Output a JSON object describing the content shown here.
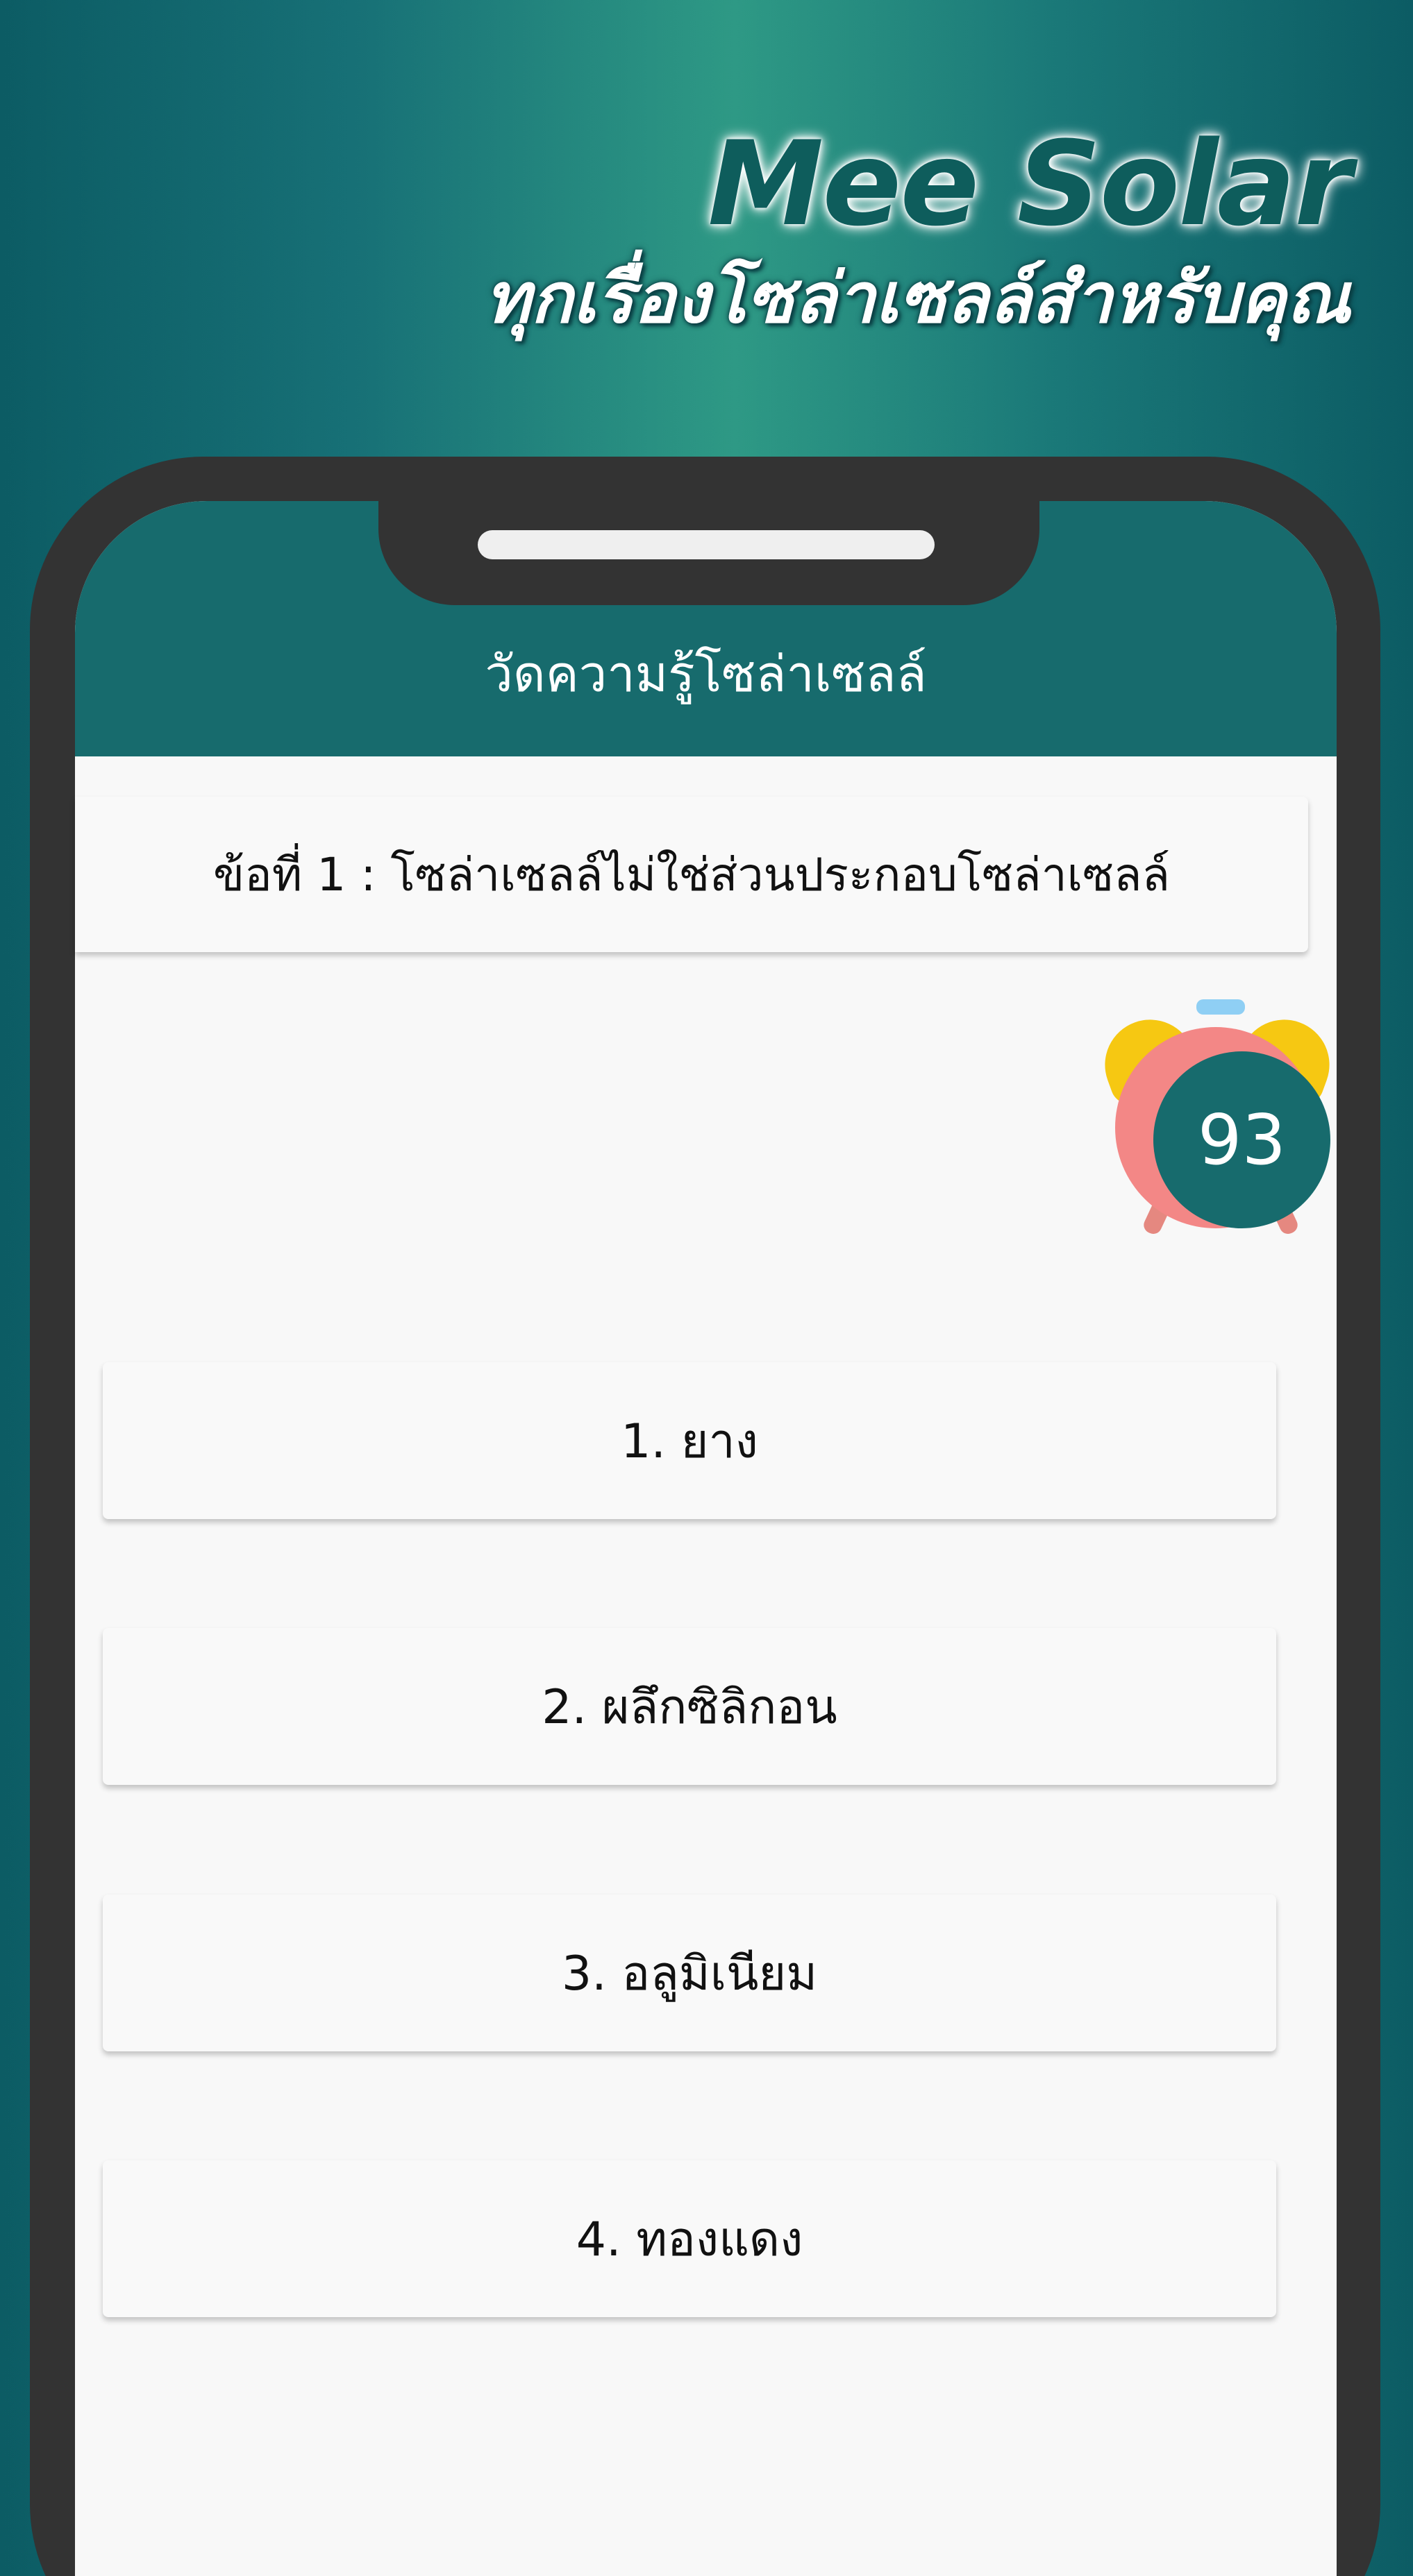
{
  "promo": {
    "brand": "Mee Solar",
    "tagline": "ทุกเรื่องโซล่าเซลล์สำหรับคุณ"
  },
  "app": {
    "title": "วัดความรู้โซล่าเซลล์"
  },
  "quiz": {
    "question": "ข้อที่ 1 : โซล่าเซลล์ไม่ใช่ส่วนประกอบโซล่าเซลล์",
    "timer": "93",
    "answers": [
      {
        "label": "1. ยาง"
      },
      {
        "label": "2. ผลึกซิลิกอน"
      },
      {
        "label": "3. อลูมิเนียม"
      },
      {
        "label": "4. ทองแดง"
      }
    ]
  },
  "colors": {
    "primary": "#176b6d",
    "brand_text": "#0e5d5c",
    "timer_ring": "#f38786",
    "timer_bells": "#f6c812"
  },
  "icons": {
    "timer": "alarm-clock-icon"
  }
}
